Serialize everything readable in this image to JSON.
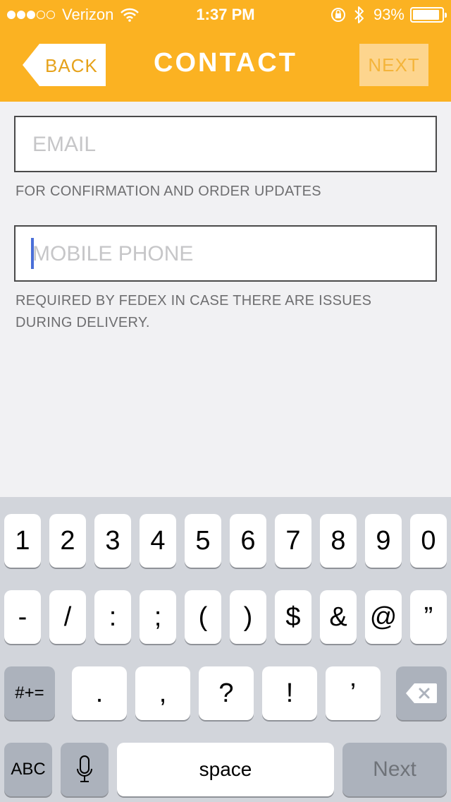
{
  "status_bar": {
    "carrier": "Verizon",
    "time": "1:37 PM",
    "battery": "93%",
    "battery_level": 0.93,
    "signal_bars_filled": 3,
    "signal_bars_total": 5
  },
  "nav": {
    "back_label": "BACK",
    "title": "CONTACT",
    "next_label": "NEXT"
  },
  "form": {
    "email": {
      "placeholder": "EMAIL",
      "value": "",
      "helper": "FOR CONFIRMATION AND ORDER UPDATES"
    },
    "phone": {
      "placeholder": "MOBILE PHONE",
      "value": "",
      "helper": "REQUIRED BY FEDEX IN CASE THERE ARE ISSUES DURING DELIVERY."
    }
  },
  "keyboard": {
    "row1": [
      "1",
      "2",
      "3",
      "4",
      "5",
      "6",
      "7",
      "8",
      "9",
      "0"
    ],
    "row2": [
      "-",
      "/",
      ":",
      ";",
      "(",
      ")",
      "$",
      "&",
      "@",
      "”"
    ],
    "row3": [
      ".",
      ",",
      "?",
      "!",
      "’"
    ],
    "symbols_label": "#+=",
    "abc_label": "ABC",
    "space_label": "space",
    "next_label": "Next"
  },
  "colors": {
    "brand": "#fbb222",
    "cursor": "#4a6fd8"
  },
  "icons": [
    "wifi-icon",
    "rotation-lock-icon",
    "bluetooth-icon",
    "battery-icon",
    "back-arrow-shape",
    "microphone-icon",
    "delete-icon"
  ]
}
